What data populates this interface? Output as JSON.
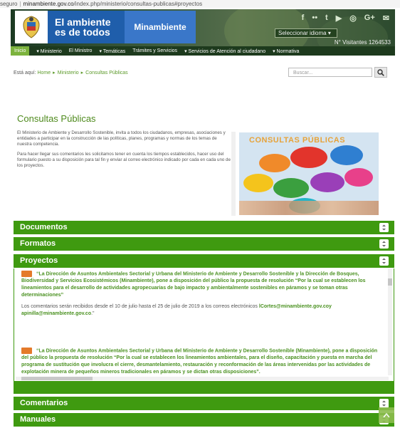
{
  "browser": {
    "security": "seguro",
    "domain": "minambiente.gov.co",
    "path": "/index.php/ministerio/consultas-publicas#proyectos"
  },
  "header": {
    "slogan_line1": "El ambiente",
    "slogan_line2": "es de todos",
    "brand": "Minambiente",
    "social_icons": [
      "facebook-icon",
      "flickr-icon",
      "twitter-icon",
      "youtube-icon",
      "instagram-icon",
      "googleplus-icon",
      "email-icon"
    ],
    "social_glyphs": [
      "f",
      "••",
      "t",
      "▶",
      "◎",
      "G+",
      "✉"
    ],
    "language_label": "Seleccionar idioma",
    "visitors": "N° Visitantes 1264533"
  },
  "nav": {
    "items": [
      "Inicio",
      "▾ Ministerio",
      "El Ministro",
      "▾ Temáticas",
      "Trámites y Servicios",
      "▾ Servicios de Atención al ciudadano",
      "▾ Normativa"
    ]
  },
  "breadcrumb": {
    "prefix": "Está aquí:",
    "items": [
      "Home",
      "Ministerio",
      "Consultas Públicas"
    ]
  },
  "search": {
    "placeholder": "Buscar..."
  },
  "page": {
    "title": "Consultas Públicas",
    "intro_p1": "El Ministerio de Ambiente y Desarrollo Sostenible, invita a todos los ciudadanos, empresas, asociaciones y entidades a participar en la construcción de las políticas, planes, programas y normas de los temas de nuestra competencia.",
    "intro_p2": "Para hacer llegar sus comentarios les solicitamos tener en cuenta los tiempos establecidos, hacer uso del formulario puesto a su disposición para tal fin y enviar al correo electrónico indicado por cada en cada uno de los proyectos.",
    "banner_title": "CONSULTAS PÚBLICAS"
  },
  "accordion": {
    "documentos": "Documentos",
    "formatos": "Formatos",
    "proyectos": "Proyectos",
    "comentarios": "Comentarios",
    "manuales": "Manuales"
  },
  "projects": [
    {
      "title": "“La Dirección de Asuntos Ambientales Sectorial y Urbana del Ministerio de Ambiente y Desarrollo Sostenible y la Dirección de Bosques, Biodiversidad y Servicios Ecosistémicos (Minambiente), pone a disposición del público la propuesta de resolución “Por la cual se establecen los lineamientos para el desarrollo de actividades agropecuarias de bajo impacto y ambientalmente sostenibles en páramos y se toman otras determinaciones”",
      "note": "Los comentarios serán recibidos desde el 10 de julio hasta el 25 de julio de 2019 a los correos electrónicos",
      "emails": "lCortes@minambiente.gov.coy apinilla@minambiente.gov.co",
      "note_end": ".\""
    },
    {
      "title": "“La Dirección de Asuntos Ambientales Sectorial y Urbana del Ministerio de Ambiente y Desarrollo Sostenible (Minambiente), pone a disposición del público la propuesta de resolución “Por la cual se establecen los lineamientos ambientales, para el diseño, capacitación y puesta en marcha del programa de sustitución que involucra el cierre, desmantelamiento, restauración y reconformación de las áreas intervenidas por las actividades de explotación minera de pequeños mineros tradicionales en páramos y se dictan otras disposiciones”."
    }
  ]
}
